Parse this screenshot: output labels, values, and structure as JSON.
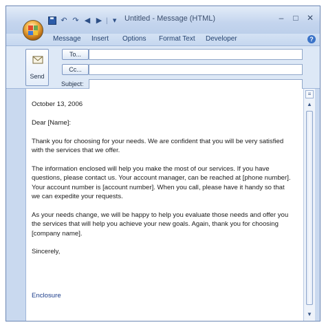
{
  "window": {
    "title": "Untitled - Message (HTML)",
    "controls": {
      "minimize": "–",
      "maximize": "□",
      "close": "✕"
    }
  },
  "quick_access": {
    "undo_glyph": "↶",
    "redo_glyph": "↷",
    "prev_glyph": "◀",
    "next_glyph": "▶",
    "customize_glyph": "▾"
  },
  "ribbon": {
    "tabs": [
      {
        "label": "Message"
      },
      {
        "label": "Insert"
      },
      {
        "label": "Options"
      },
      {
        "label": "Format Text"
      },
      {
        "label": "Developer"
      }
    ],
    "help_glyph": "?"
  },
  "header": {
    "send_label": "Send",
    "to_label": "To...",
    "cc_label": "Cc...",
    "subject_label": "Subject:",
    "to_value": "",
    "cc_value": "",
    "subject_value": ""
  },
  "message": {
    "date": "October 13, 2006",
    "salutation": "Dear [Name]:",
    "paragraphs": [
      "Thank you for choosing for your needs. We are confident that you will be very satisfied with the services that we offer.",
      "The information enclosed will help you make the most of our services. If you have questions, please contact us. Your account manager, can be reached at [phone number]. Your account number is [account number]. When you call, please have it handy so that we can expedite your requests.",
      "As your needs change, we will be happy to help you evaluate those needs and offer you the services that will help you achieve your new goals. Again, thank you for choosing [company name]."
    ],
    "closing": "Sincerely,",
    "enclosure": "Enclosure"
  },
  "scrollbar": {
    "up_glyph": "▲",
    "down_glyph": "▼",
    "ruler_glyph": "≡"
  },
  "colors": {
    "office_logo": [
      "#e2492b",
      "#6aa84f",
      "#3d78d8",
      "#f1c232"
    ]
  }
}
